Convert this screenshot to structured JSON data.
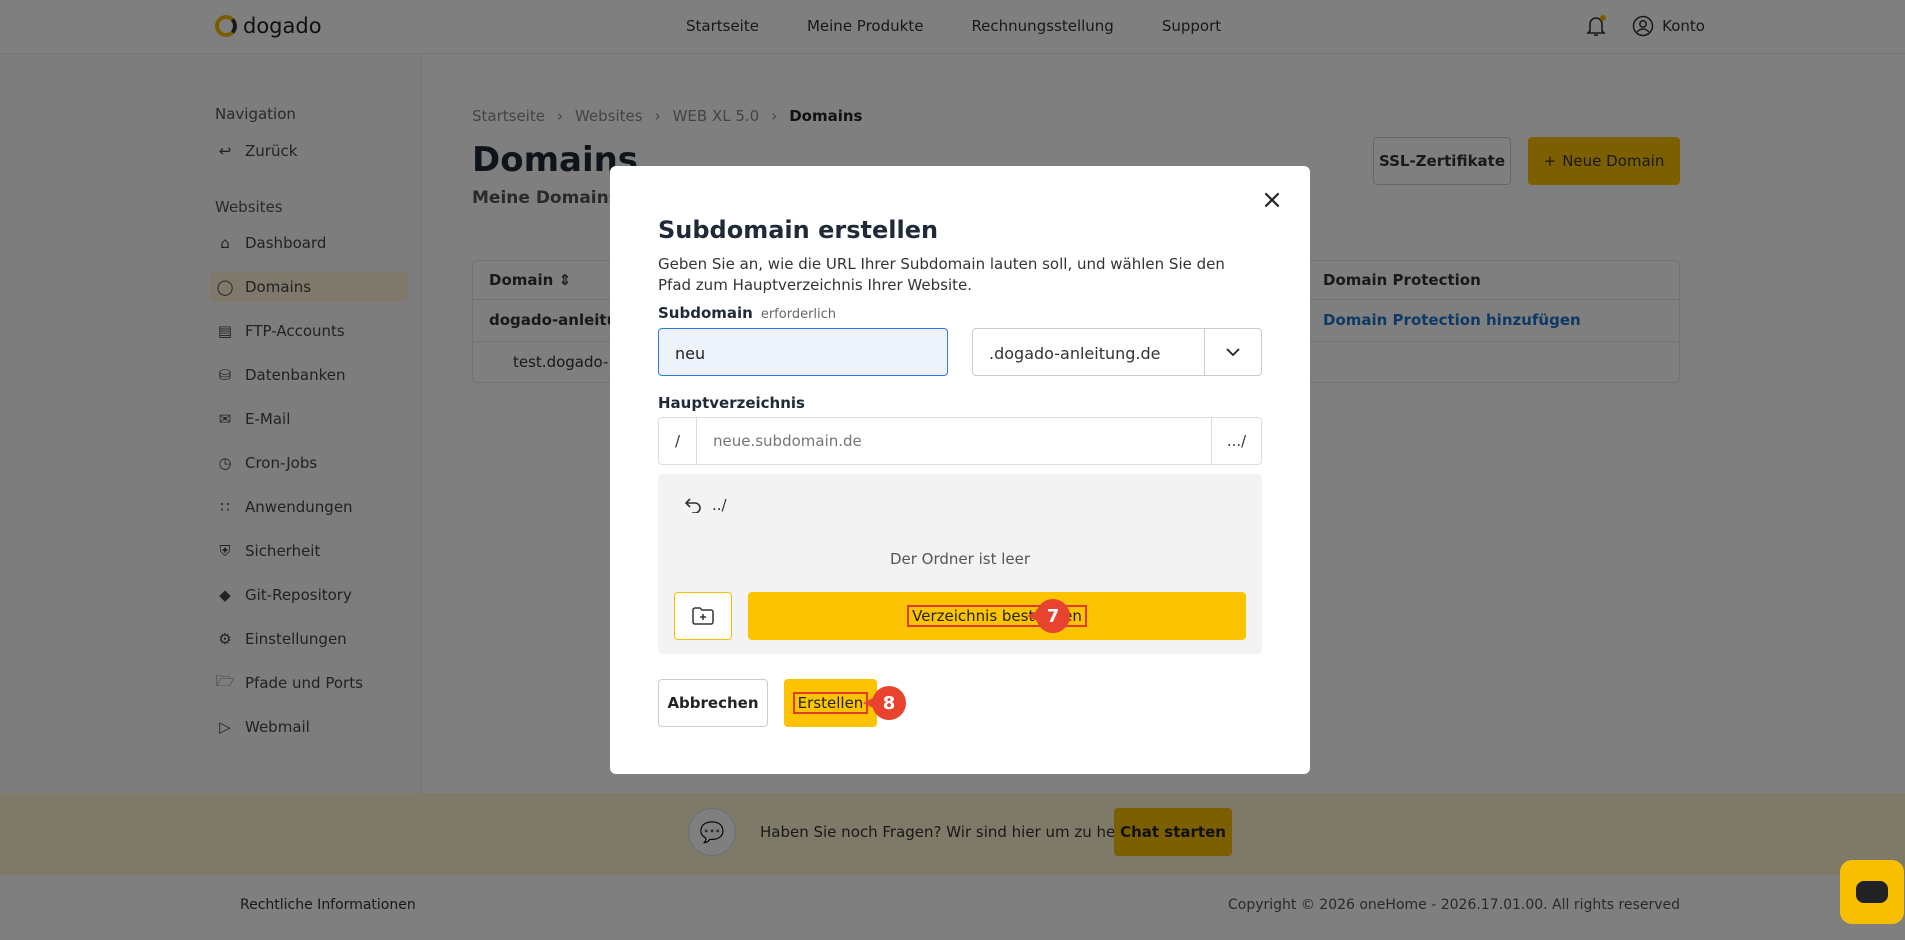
{
  "header": {
    "logo": "dogado",
    "nav": [
      "Startseite",
      "Meine Produkte",
      "Rechnungsstellung",
      "Support"
    ],
    "account": "Konto"
  },
  "sidebar": {
    "nav_title": "Navigation",
    "back": "Zurück",
    "websites_title": "Websites",
    "items": [
      {
        "label": "Dashboard",
        "icon": "home-icon"
      },
      {
        "label": "Domains",
        "icon": "globe-icon"
      },
      {
        "label": "FTP-Accounts",
        "icon": "server-icon"
      },
      {
        "label": "Datenbanken",
        "icon": "database-icon"
      },
      {
        "label": "E-Mail",
        "icon": "mail-icon"
      },
      {
        "label": "Cron-Jobs",
        "icon": "clock-icon"
      },
      {
        "label": "Anwendungen",
        "icon": "grid-icon"
      },
      {
        "label": "Sicherheit",
        "icon": "shield-icon"
      },
      {
        "label": "Git-Repository",
        "icon": "git-icon"
      },
      {
        "label": "Einstellungen",
        "icon": "gear-icon"
      },
      {
        "label": "Pfade und Ports",
        "icon": "folder-icon"
      },
      {
        "label": "Webmail",
        "icon": "send-icon"
      }
    ]
  },
  "main": {
    "breadcrumb": [
      "Startseite",
      "Websites",
      "WEB XL 5.0",
      "Domains"
    ],
    "title": "Domains",
    "subtitle": "Meine Domains",
    "ssl_button": "SSL-Zertifikate",
    "new_domain_button": "Neue Domain",
    "table": {
      "col_domain": "Domain",
      "col_protection": "Domain Protection",
      "row1_domain": "dogado-anleitung",
      "row1_protection": "Domain Protection hinzufügen",
      "row2_domain": "test.dogado-"
    }
  },
  "modal": {
    "title": "Subdomain erstellen",
    "description": "Geben Sie an, wie die URL Ihrer Subdomain lauten soll, und wählen Sie den Pfad zum Hauptverzeichnis Ihrer Website.",
    "subdomain_label": "Subdomain",
    "required": "erforderlich",
    "subdomain_value": "neu",
    "domain_select": ".dogado-anleitung.de",
    "root_label": "Hauptverzeichnis",
    "path_prefix": "/",
    "path_placeholder": "neue.subdomain.de",
    "path_button": ".../",
    "up_label": "../",
    "empty_text": "Der Ordner ist leer",
    "confirm_button": "Verzeichnis bestätigen",
    "confirm_step": "7",
    "cancel_button": "Abbrechen",
    "create_button": "Erstellen",
    "create_step": "8"
  },
  "help": {
    "text": "Haben Sie noch Fragen? Wir sind hier um zu helfen.",
    "button": "Chat starten"
  },
  "footer": {
    "legal": "Rechtliche Informationen",
    "copyright": "Copyright © 2026 oneHome - 2026.17.01.00. All rights reserved"
  },
  "colors": {
    "accent": "#f8bf00",
    "annotation": "#e8432e",
    "focus": "#2d7be0"
  }
}
